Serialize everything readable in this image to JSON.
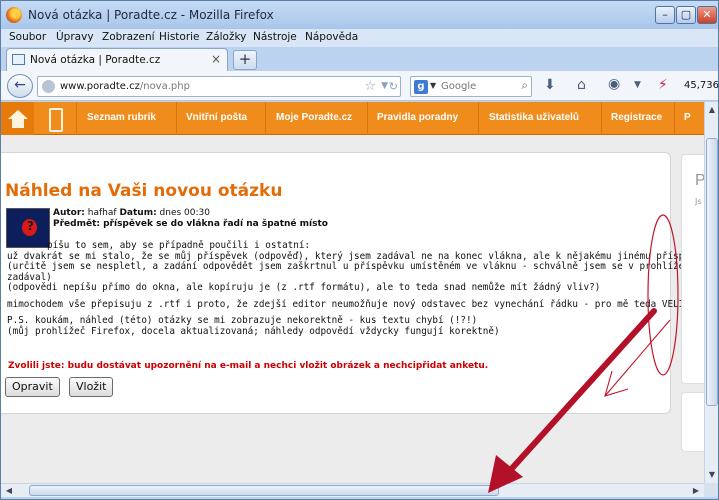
{
  "window": {
    "title": "Nová otázka | Poradte.cz - Mozilla Firefox",
    "buttons": {
      "minimize": "–",
      "maximize": "▢",
      "close": "✕"
    }
  },
  "menu": [
    "Soubor",
    "Úpravy",
    "Zobrazení",
    "Historie",
    "Záložky",
    "Nástroje",
    "Nápověda"
  ],
  "tab": {
    "title": "Nová otázka | Poradte.cz",
    "close": "×",
    "new_tab": "+"
  },
  "navbar": {
    "url_host": "www.poradte.cz",
    "url_path": "/nova.php",
    "search_placeholder": "Google",
    "counter": "45,736"
  },
  "site_nav": [
    "Seznam rubrik",
    "Vnitřní pošta",
    "Moje Poradte.cz",
    "Pravidla poradny",
    "Statistika uživatelů",
    "Registrace",
    "P"
  ],
  "post": {
    "heading": "Náhled na Vaši novou otázku",
    "author_label": "Autor:",
    "author": "hafhaf",
    "date_label": "Datum:",
    "date": "dnes 00:30",
    "subject_label": "Předmět:",
    "subject": "příspěvek se do vlákna řadí na špatné místo",
    "lines": [
      "píšu to sem, aby se případně poučili i ostatní:",
      "už dvakrát se mi stalo, že se můj příspěvek (odpověď), který jsem zadával ne na konec vlákna, ale k nějakému jinému příspěvku",
      "(určitě jsem se nespletl, a zadání odpovědět jsem zaškrtnul u příspěvku umístěném ve vláknu - schválně jsem se v prohlížeči posu",
      "zadával)",
      "(odpovědi nepíšu přímo do okna, ale kopíruju je (z .rtf formátu), ale to teda snad nemůže mít žádný vliv?)",
      "mimochodem vše přepisuju z .rtf i proto, že zdejší editor neumožňuje nový odstavec bez vynechání řádku - pro mě teda VELICE pro",
      "P.S. koukám, náhled (této) otázky se mi zobrazuje nekorektně - kus textu chybí (!?!)",
      "(můj prohlížeč Firefox, docela aktualizovaná; náhledy odpovědí vždycky fungují korektně)"
    ],
    "notice": "Zvolili jste: budu dostávat upozornění na e-mail a nechci vložit obrázek a nechcipřidat anketu.",
    "edit_button": "Opravit",
    "submit_button": "Vložit"
  },
  "side_panel": {
    "letter": "P",
    "sub": "Js"
  },
  "colors": {
    "site_orange": "#f08c1c",
    "heading_orange": "#e36c09",
    "notice_red": "#cc0000",
    "annotation_red": "#c4152a"
  }
}
